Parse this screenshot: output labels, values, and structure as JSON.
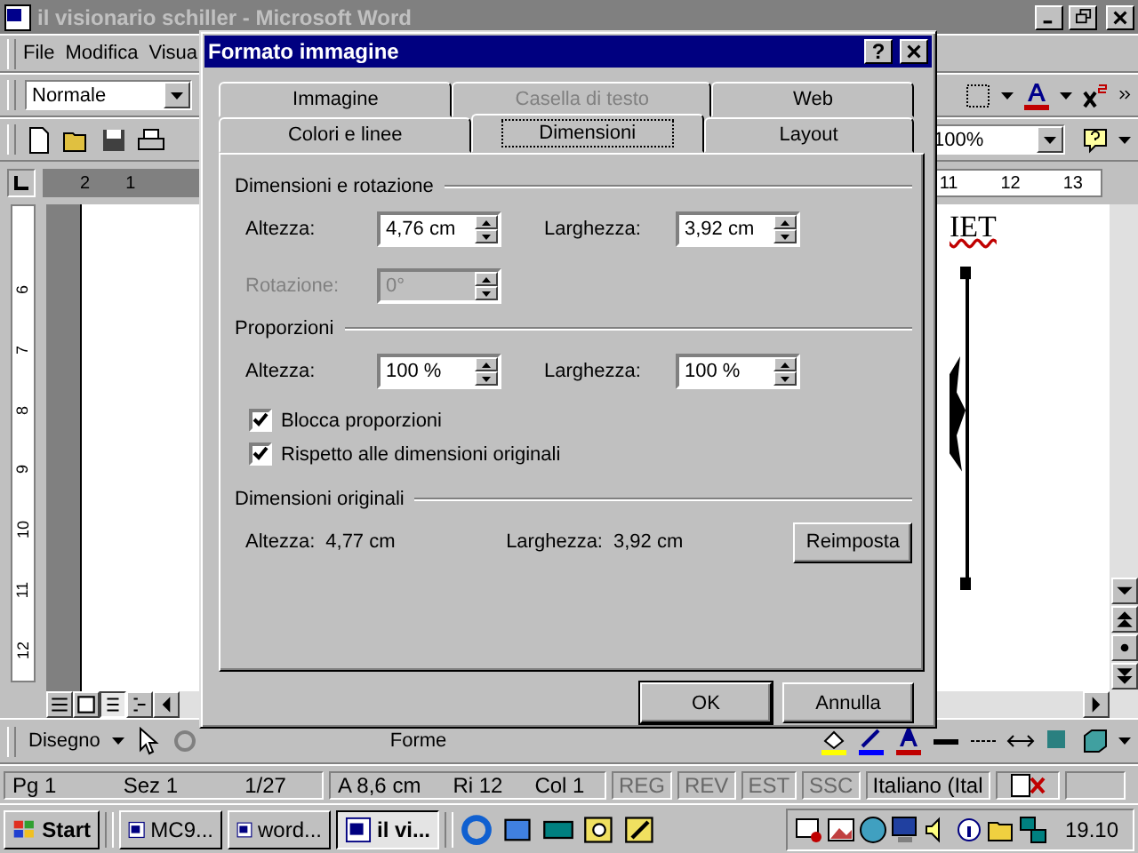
{
  "window": {
    "title": "il visionario schiller - Microsoft Word"
  },
  "menu": [
    "File",
    "Modifica",
    "Visua"
  ],
  "formatting_toolbar": {
    "style": "Normale"
  },
  "standard_toolbar": {
    "zoom": "100%"
  },
  "ruler": {
    "left_marks": [
      "2",
      "1"
    ],
    "right_marks": [
      "11",
      "12",
      "13"
    ]
  },
  "vertical_ruler": [
    "6",
    "7",
    "8",
    "9",
    "10",
    "11",
    "12"
  ],
  "document": {
    "text_fragment": "IET"
  },
  "dialog": {
    "title": "Formato immagine",
    "help": "?",
    "tabs_back": [
      {
        "label": "Immagine",
        "disabled": false
      },
      {
        "label": "Casella di testo",
        "disabled": true
      },
      {
        "label": "Web",
        "disabled": false
      }
    ],
    "tabs_front": [
      {
        "label": "Colori e linee",
        "selected": false
      },
      {
        "label": "Dimensioni",
        "selected": true
      },
      {
        "label": "Layout",
        "selected": false
      }
    ],
    "size_rotation": {
      "heading": "Dimensioni e rotazione",
      "height": {
        "label": "Altezza:",
        "value": "4,76 cm"
      },
      "width": {
        "label": "Larghezza:",
        "value": "3,92 cm"
      },
      "rotation": {
        "label": "Rotazione:",
        "value": "0°",
        "disabled": true
      }
    },
    "scale": {
      "heading": "Proporzioni",
      "height": {
        "label": "Altezza:",
        "value": "100 %"
      },
      "width": {
        "label": "Larghezza:",
        "value": "100 %"
      },
      "checkboxes": [
        {
          "label": "Blocca proporzioni",
          "checked": true
        },
        {
          "label": "Rispetto alle dimensioni originali",
          "checked": true
        }
      ]
    },
    "original": {
      "heading": "Dimensioni originali",
      "height_label": "Altezza:",
      "height": "4,77 cm",
      "width_label": "Larghezza:",
      "width": "3,92 cm",
      "button": "Reimposta"
    },
    "buttons": [
      "OK",
      "Annulla"
    ]
  },
  "drawing_toolbar": {
    "draw": "Disegno",
    "shapes": "Forme"
  },
  "status_bar": [
    {
      "text": "Pg 1",
      "disabled": false
    },
    {
      "text": "Sez 1",
      "disabled": false
    },
    {
      "text": "1/27",
      "disabled": false
    },
    {
      "text": "A 8,6 cm",
      "disabled": false
    },
    {
      "text": "Ri 12",
      "disabled": false
    },
    {
      "text": "Col 1",
      "disabled": false
    },
    {
      "text": "REG",
      "disabled": true
    },
    {
      "text": "REV",
      "disabled": true
    },
    {
      "text": "EST",
      "disabled": true
    },
    {
      "text": "SSC",
      "disabled": true
    },
    {
      "text": "Italiano (Ital",
      "disabled": false
    }
  ],
  "taskbar": {
    "start": "Start",
    "tasks": [
      {
        "label": "MC9...",
        "selected": false
      },
      {
        "label": "word...",
        "selected": false
      },
      {
        "label": "il vi...",
        "selected": true
      }
    ],
    "clock": "19.10"
  }
}
